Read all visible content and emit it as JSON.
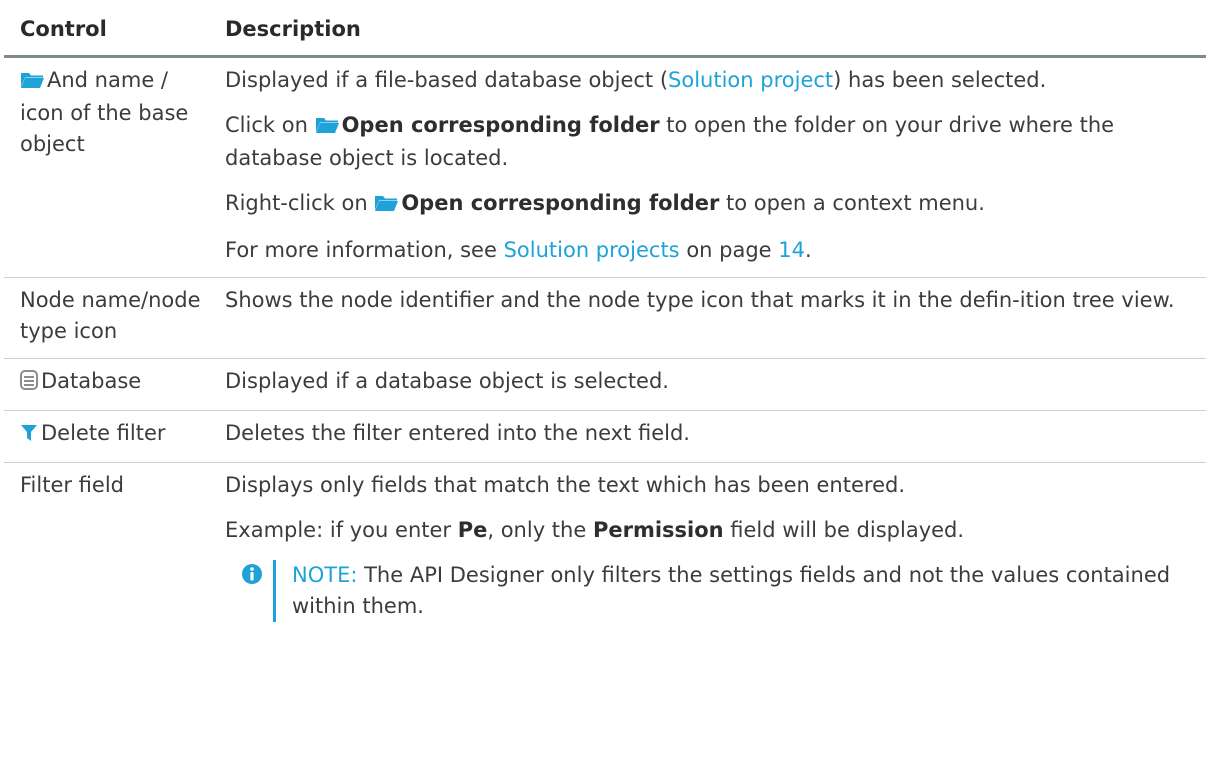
{
  "headers": {
    "control": "Control",
    "description": "Description"
  },
  "rows": [
    {
      "control": "And name / icon of the base object",
      "icon": "folder-icon",
      "desc": [
        {
          "a": "Displayed if a file-based database object (",
          "link": "Solution project",
          "b": ") has been selected."
        },
        {
          "a": "Click on ",
          "bold": "Open corresponding folder",
          "b": " to open the folder on your drive where the database object is located."
        },
        {
          "a": "Right-click on ",
          "bold": "Open corresponding folder",
          "b": " to open a context menu."
        },
        {
          "a": "For more information, see ",
          "link": "Solution projects",
          "b": " on page ",
          "link2": "14",
          "c": "."
        }
      ]
    },
    {
      "control": "Node name/node type icon",
      "desc": [
        {
          "a": "Shows the node identifier and the node type icon that marks it in the defin-ition tree view."
        }
      ]
    },
    {
      "control": "Database",
      "icon": "database-icon",
      "desc": [
        {
          "a": "Displayed if a database object is selected."
        }
      ]
    },
    {
      "control": "Delete filter",
      "icon": "filter-icon",
      "desc": [
        {
          "a": "Deletes the filter entered into the next field."
        }
      ]
    },
    {
      "control": "Filter field",
      "desc": [
        {
          "a": "Displays only fields that match the text which has been entered."
        },
        {
          "a": "Example: if you enter ",
          "bold": "Pe",
          "b": ", only the ",
          "bold2": "Permission",
          "c": " field will be displayed."
        }
      ],
      "note": {
        "icon": "info-icon",
        "label": "NOTE:",
        "text": " The API Designer only filters the settings fields and not the values contained within them."
      }
    }
  ],
  "colors": {
    "link": "#1fa2d8",
    "folder": "#1fa2d8",
    "filter": "#1fa2d8",
    "database": "#8c8c8c",
    "rule": "#808a8e"
  }
}
